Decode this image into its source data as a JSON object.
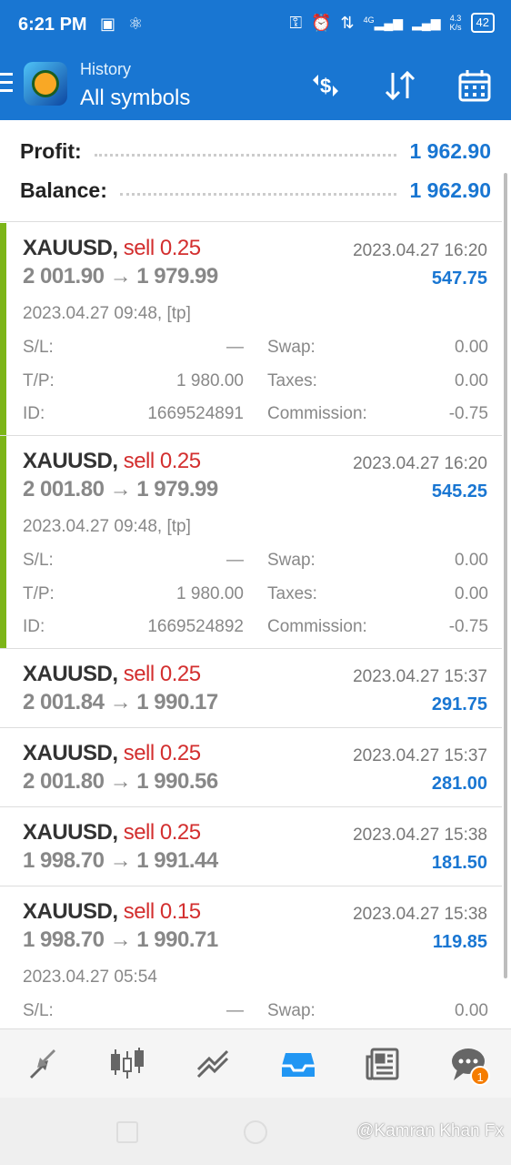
{
  "status_bar": {
    "time": "6:21 PM",
    "net_speed": "4.3",
    "net_unit": "K/s",
    "network": "4G",
    "battery": "42"
  },
  "app_bar": {
    "subtitle": "History",
    "title": "All symbols",
    "actions": [
      "currency-exchange-icon",
      "sort-icon",
      "calendar-icon"
    ]
  },
  "summary": {
    "profit_label": "Profit:",
    "profit_value": "1 962.90",
    "balance_label": "Balance:",
    "balance_value": "1 962.90"
  },
  "trades": [
    {
      "symbol": "XAUUSD,",
      "side": "sell 0.25",
      "close_time": "2023.04.27 16:20",
      "prices": "2 001.90 → 1 979.99",
      "profit": "547.75",
      "open_time": "2023.04.27 09:48, [tp]",
      "sl_label": "S/L:",
      "sl": "—",
      "tp_label": "T/P:",
      "tp": "1 980.00",
      "id_label": "ID:",
      "id": "1669524891",
      "swap_label": "Swap:",
      "swap": "0.00",
      "taxes_label": "Taxes:",
      "taxes": "0.00",
      "commission_label": "Commission:",
      "commission": "-0.75"
    },
    {
      "symbol": "XAUUSD,",
      "side": "sell 0.25",
      "close_time": "2023.04.27 16:20",
      "prices": "2 001.80 → 1 979.99",
      "profit": "545.25",
      "open_time": "2023.04.27 09:48, [tp]",
      "sl_label": "S/L:",
      "sl": "—",
      "tp_label": "T/P:",
      "tp": "1 980.00",
      "id_label": "ID:",
      "id": "1669524892",
      "swap_label": "Swap:",
      "swap": "0.00",
      "taxes_label": "Taxes:",
      "taxes": "0.00",
      "commission_label": "Commission:",
      "commission": "-0.75"
    },
    {
      "symbol": "XAUUSD,",
      "side": "sell 0.25",
      "close_time": "2023.04.27 15:37",
      "prices": "2 001.84 → 1 990.17",
      "profit": "291.75"
    },
    {
      "symbol": "XAUUSD,",
      "side": "sell 0.25",
      "close_time": "2023.04.27 15:37",
      "prices": "2 001.80 → 1 990.56",
      "profit": "281.00"
    },
    {
      "symbol": "XAUUSD,",
      "side": "sell 0.25",
      "close_time": "2023.04.27 15:38",
      "prices": "1 998.70 → 1 991.44",
      "profit": "181.50"
    },
    {
      "symbol": "XAUUSD,",
      "side": "sell 0.15",
      "close_time": "2023.04.27 15:38",
      "prices": "1 998.70 → 1 990.71",
      "profit": "119.85",
      "open_time": "2023.04.27 05:54",
      "sl_label": "S/L:",
      "sl": "—",
      "swap_label": "Swap:",
      "swap": "0.00"
    }
  ],
  "bottom_nav": {
    "items": [
      "quotes-icon",
      "chart-icon",
      "trade-icon",
      "history-icon",
      "news-icon",
      "chat-icon"
    ],
    "chat_badge": "1"
  },
  "watermark": "@Kamran Khan Fx",
  "colors": {
    "primary": "#1976d2",
    "sell": "#d32f2f",
    "accent": "#7cb518"
  }
}
